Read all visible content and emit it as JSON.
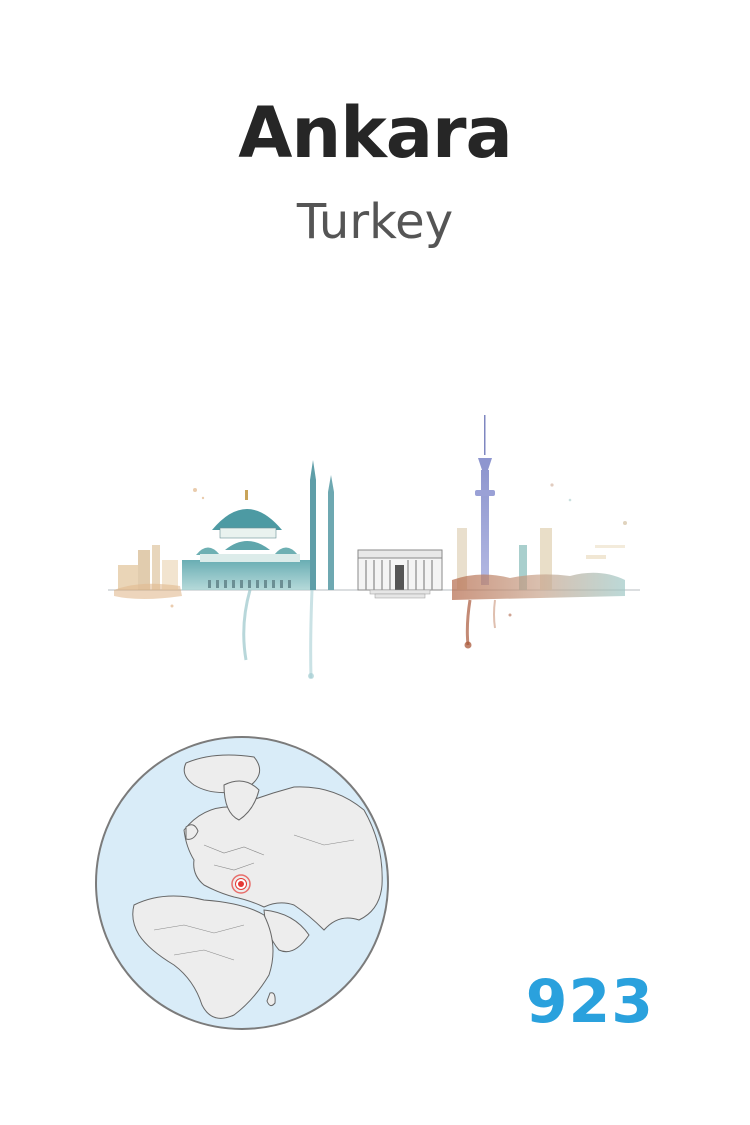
{
  "card": {
    "city": "Ankara",
    "country": "Turkey",
    "number": "923"
  },
  "illustration": {
    "skyline_icon": "watercolor-skyline-illustration",
    "globe_icon": "globe-map-icon",
    "location_marker_icon": "location-target-icon"
  },
  "colors": {
    "title": "#262626",
    "subtitle": "#555555",
    "number": "#2aa1dd",
    "ocean": "#d9ecf8",
    "land": "#ededed",
    "marker": "#e53935"
  }
}
